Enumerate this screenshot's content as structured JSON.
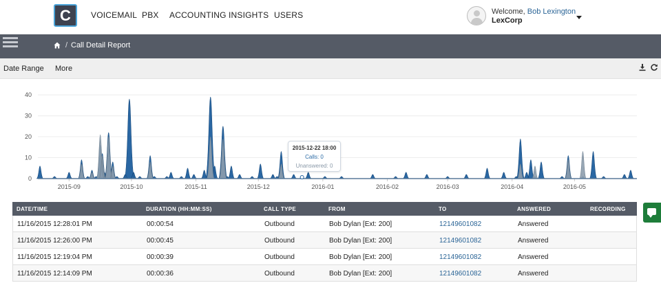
{
  "nav": {
    "logo_letter": "C",
    "items": [
      "VOICEMAIL",
      "PBX",
      "ACCOUNTING",
      "INSIGHTS",
      "USERS"
    ],
    "welcome_prefix": "Welcome, ",
    "user_name": "Bob Lexington",
    "company": "LexCorp"
  },
  "breadcrumb": {
    "separator": "/",
    "current": "Call Detail Report"
  },
  "filters": {
    "date_range": "Date Range",
    "more": "More"
  },
  "icons": {
    "menu": "list-icon",
    "home": "home-icon",
    "download": "download-icon",
    "refresh": "refresh-icon",
    "chat": "chat-icon",
    "avatar": "user-icon"
  },
  "colors": {
    "calls": "#1f5f9e",
    "unanswered": "#8d9dad",
    "header_bg": "#555b66",
    "link": "#2a6496"
  },
  "chart_data": {
    "type": "area",
    "y_ticks": [
      "0",
      "10",
      "20",
      "30",
      "40"
    ],
    "ylim": [
      0,
      42
    ],
    "x_tick_labels": [
      "2015-09",
      "2015-10",
      "2015-11",
      "2015-12",
      "2016-01",
      "2016-02",
      "2016-03",
      "2016-04",
      "2016-05"
    ],
    "grid": true,
    "series": [
      {
        "name": "Calls",
        "x": [
          "2015-08-18",
          "2015-08-20",
          "2015-08-25",
          "2015-08-27",
          "2015-09-01",
          "2015-09-05",
          "2015-09-07",
          "2015-09-10",
          "2015-09-12",
          "2015-09-14",
          "2015-09-16",
          "2015-09-17",
          "2015-09-18",
          "2015-09-20",
          "2015-09-22",
          "2015-09-24",
          "2015-09-26",
          "2015-09-28",
          "2015-09-30",
          "2015-10-02",
          "2015-10-05",
          "2015-10-08",
          "2015-10-10",
          "2015-10-12",
          "2015-10-15",
          "2015-10-18",
          "2015-10-20",
          "2015-10-25",
          "2015-10-28",
          "2015-10-31",
          "2015-11-02",
          "2015-11-05",
          "2015-11-08",
          "2015-11-10",
          "2015-11-12",
          "2015-11-14",
          "2015-11-16",
          "2015-11-18",
          "2015-11-20",
          "2015-11-22",
          "2015-11-25",
          "2015-11-28",
          "2015-12-02",
          "2015-12-05",
          "2015-12-08",
          "2015-12-10",
          "2015-12-12",
          "2015-12-15",
          "2015-12-18",
          "2015-12-20",
          "2015-12-22",
          "2015-12-25",
          "2015-12-28",
          "2016-01-02",
          "2016-01-05",
          "2016-01-10",
          "2016-01-15",
          "2016-01-20",
          "2016-01-25",
          "2016-01-30",
          "2016-02-05",
          "2016-02-10",
          "2016-02-15",
          "2016-02-20",
          "2016-02-25",
          "2016-03-01",
          "2016-03-05",
          "2016-03-10",
          "2016-03-15",
          "2016-03-20",
          "2016-03-25",
          "2016-03-28",
          "2016-03-31",
          "2016-04-03",
          "2016-04-05",
          "2016-04-08",
          "2016-04-10",
          "2016-04-12",
          "2016-04-15",
          "2016-04-18",
          "2016-04-20",
          "2016-04-25",
          "2016-04-28",
          "2016-05-02",
          "2016-05-05",
          "2016-05-10",
          "2016-05-15",
          "2016-05-20",
          "2016-05-25",
          "2016-05-28"
        ],
        "values": [
          6,
          0,
          1,
          0,
          3,
          0,
          9,
          1,
          4,
          1,
          16,
          12,
          3,
          22,
          8,
          1,
          0,
          2,
          38,
          3,
          1,
          0,
          11,
          1,
          0,
          1,
          3,
          1,
          5,
          2,
          0,
          4,
          39,
          6,
          0,
          25,
          1,
          6,
          0,
          2,
          0,
          1,
          7,
          0,
          2,
          1,
          13,
          0,
          2,
          0,
          1,
          3,
          0,
          1,
          0,
          1,
          0,
          0,
          2,
          0,
          1,
          3,
          0,
          2,
          0,
          1,
          0,
          2,
          0,
          5,
          0,
          3,
          0,
          1,
          19,
          3,
          9,
          1,
          8,
          0,
          0,
          1,
          11,
          0,
          1,
          13,
          1,
          0,
          2,
          4
        ]
      },
      {
        "name": "Unanswered",
        "x": [
          "2015-09-07",
          "2015-09-12",
          "2015-09-16",
          "2015-09-17",
          "2015-09-20",
          "2015-09-22",
          "2015-10-10",
          "2015-11-08",
          "2015-11-14",
          "2015-12-12",
          "2016-04-05",
          "2016-04-12",
          "2016-04-28",
          "2016-05-05"
        ],
        "values": [
          7,
          3,
          21,
          11,
          20,
          6,
          8,
          20,
          19,
          7,
          7,
          6,
          9,
          13
        ]
      }
    ]
  },
  "tooltip": {
    "title": "2015-12-22 18:00",
    "calls": "Calls: 0",
    "unanswered": "Unanswered: 0"
  },
  "table": {
    "headers": [
      "DATE/TIME",
      "DURATION (HH:MM:SS)",
      "CALL TYPE",
      "FROM",
      "TO",
      "ANSWERED",
      "RECORDING"
    ],
    "rows": [
      [
        "11/16/2015 12:28:01 PM",
        "00:00:54",
        "Outbound",
        "Bob Dylan [Ext: 200]",
        "12149601082",
        "Answered",
        ""
      ],
      [
        "11/16/2015 12:26:00 PM",
        "00:00:45",
        "Outbound",
        "Bob Dylan [Ext: 200]",
        "12149601082",
        "Answered",
        ""
      ],
      [
        "11/16/2015 12:19:04 PM",
        "00:00:39",
        "Outbound",
        "Bob Dylan [Ext: 200]",
        "12149601082",
        "Answered",
        ""
      ],
      [
        "11/16/2015 12:14:09 PM",
        "00:00:36",
        "Outbound",
        "Bob Dylan [Ext: 200]",
        "12149601082",
        "Answered",
        ""
      ]
    ]
  }
}
